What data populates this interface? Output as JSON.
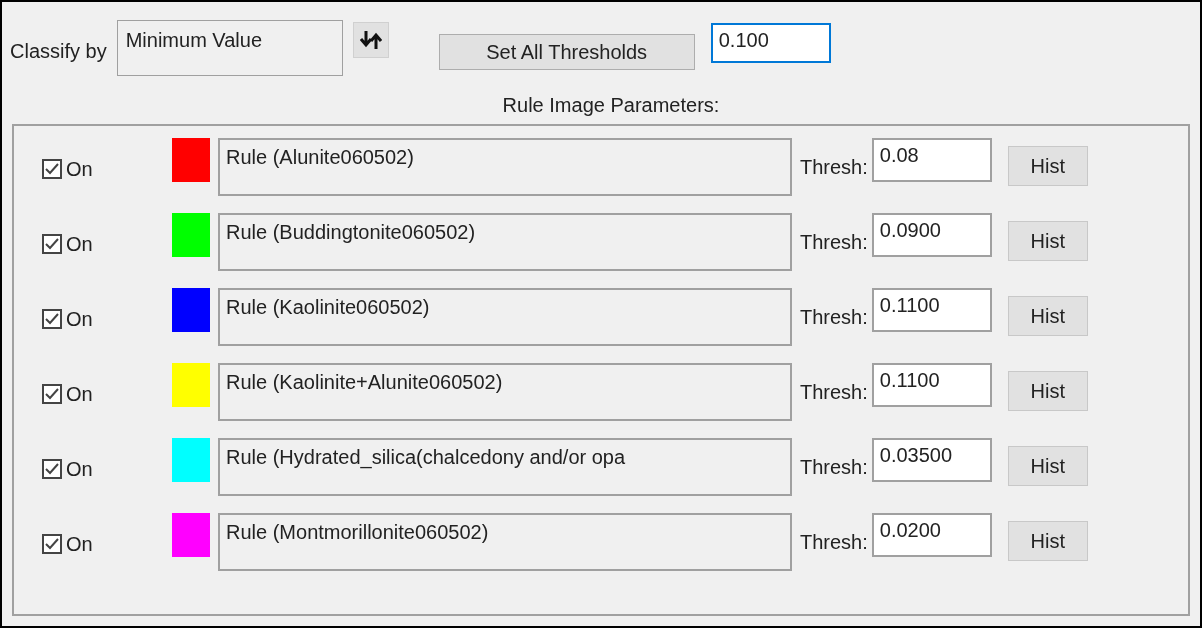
{
  "classify": {
    "label": "Classify by",
    "value": "Minimum Value"
  },
  "set_all_button": "Set All Thresholds",
  "threshold": "0.100",
  "group_title": "Rule Image Parameters:",
  "rules": [
    {
      "on": true,
      "on_label": "On",
      "color": "#ff0000",
      "name": "Rule (Alunite060502)",
      "thresh_label": "Thresh:",
      "thresh": "0.08",
      "hist": "Hist"
    },
    {
      "on": true,
      "on_label": "On",
      "color": "#00ff00",
      "name": "Rule (Buddingtonite060502)",
      "thresh_label": "Thresh:",
      "thresh": "0.0900",
      "hist": "Hist"
    },
    {
      "on": true,
      "on_label": "On",
      "color": "#0000ff",
      "name": "Rule (Kaolinite060502)",
      "thresh_label": "Thresh:",
      "thresh": "0.1100",
      "hist": "Hist"
    },
    {
      "on": true,
      "on_label": "On",
      "color": "#ffff00",
      "name": "Rule (Kaolinite+Alunite060502)",
      "thresh_label": "Thresh:",
      "thresh": "0.1100",
      "hist": "Hist"
    },
    {
      "on": true,
      "on_label": "On",
      "color": "#00ffff",
      "name": "Rule (Hydrated_silica(chalcedony and/or opa",
      "thresh_label": "Thresh:",
      "thresh": "0.03500",
      "hist": "Hist"
    },
    {
      "on": true,
      "on_label": "On",
      "color": "#ff00ff",
      "name": "Rule (Montmorillonite060502)",
      "thresh_label": "Thresh:",
      "thresh": "0.0200",
      "hist": "Hist"
    }
  ]
}
